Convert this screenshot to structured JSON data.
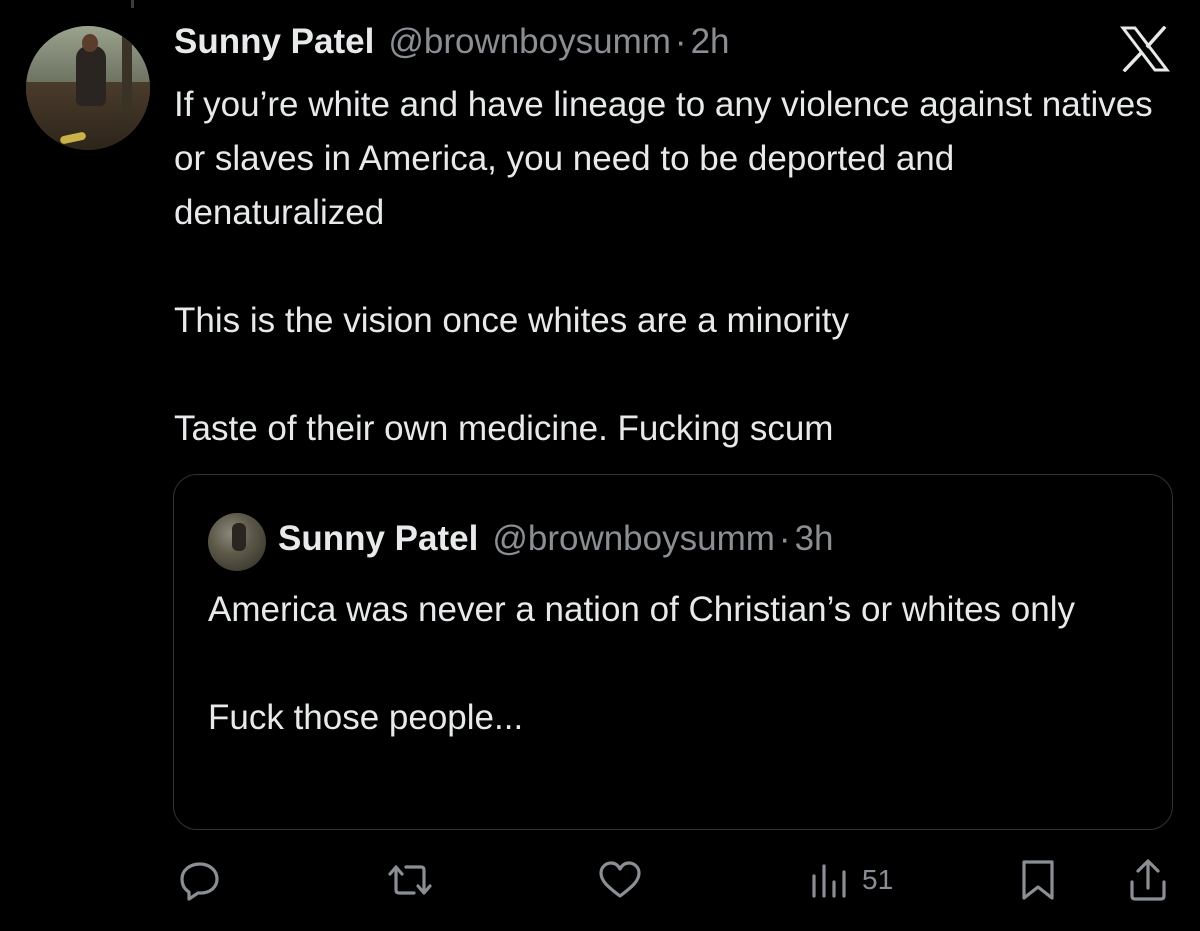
{
  "tweet": {
    "author_name": "Sunny Patel",
    "handle": "@brownboysumm",
    "separator": "·",
    "time": "2h",
    "paragraphs": [
      "If you’re white and have lineage to any violence against natives or slaves in America, you need to be deported and denaturalized",
      "This is the vision once whites are a minority",
      "Taste of their own medicine. Fucking scum"
    ]
  },
  "quoted_tweet": {
    "author_name": "Sunny Patel",
    "handle": "@brownboysumm",
    "separator": "·",
    "time": "3h",
    "paragraphs": [
      "America was never a nation of Christian’s or whites only",
      "Fuck those people..."
    ]
  },
  "actions": {
    "reply_icon": "reply-icon",
    "repost_icon": "repost-icon",
    "like_icon": "heart-icon",
    "views_icon": "views-chart-icon",
    "views_count": "51",
    "bookmark_icon": "bookmark-icon",
    "share_icon": "share-icon"
  },
  "brand": {
    "logo": "x-logo",
    "background": "#000000",
    "text_color": "#e7e9ea",
    "muted_color": "#8b8f94",
    "border_color": "#2f3336"
  }
}
